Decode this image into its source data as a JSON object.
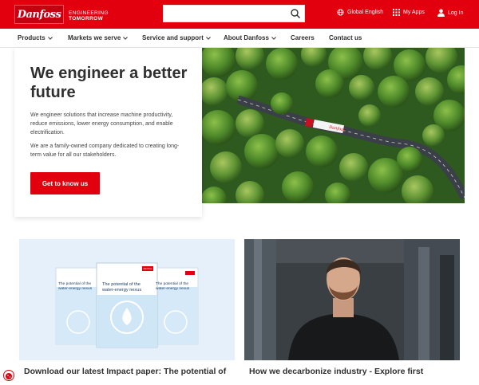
{
  "header": {
    "logo_text": "Danfoss",
    "tagline_line1": "ENGINEERING",
    "tagline_line2": "TOMORROW",
    "search_placeholder": "",
    "global_label": "Global English",
    "apps_label": "My Apps",
    "login_label": "Log In",
    "brand_color": "#e2000f"
  },
  "nav": {
    "items": [
      {
        "label": "Products",
        "has_dropdown": true
      },
      {
        "label": "Markets we serve",
        "has_dropdown": true
      },
      {
        "label": "Service and support",
        "has_dropdown": true
      },
      {
        "label": "About Danfoss",
        "has_dropdown": true
      },
      {
        "label": "Careers",
        "has_dropdown": false
      },
      {
        "label": "Contact us",
        "has_dropdown": false
      }
    ]
  },
  "hero": {
    "title": "We engineer a better future",
    "paragraph1": "We engineer solutions that increase machine productivity, reduce emissions, lower energy consumption, and enable electrification.",
    "paragraph2": "We are a family-owned company dedicated to creating long-term value for all our stakeholders.",
    "cta_label": "Get to know us"
  },
  "cards": [
    {
      "title": "Download our latest Impact paper: The potential of",
      "booklet_title": "The potential of the water-energy nexus",
      "booklet_brand": "Danfoss"
    },
    {
      "title": "How we decarbonize industry - Explore first"
    }
  ]
}
